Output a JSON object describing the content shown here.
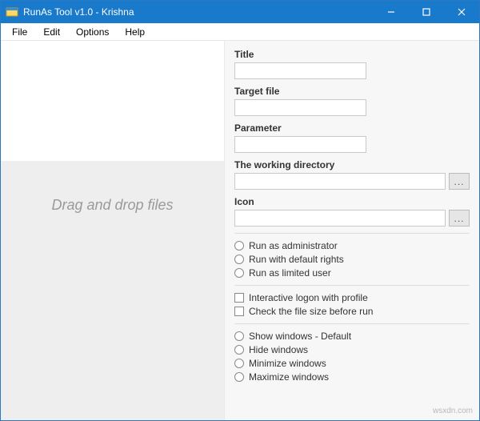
{
  "titlebar": {
    "title": "RunAs Tool v1.0 - Krishna"
  },
  "menu": {
    "file": "File",
    "edit": "Edit",
    "options": "Options",
    "help": "Help"
  },
  "left": {
    "drop_hint": "Drag and drop files"
  },
  "fields": {
    "title": {
      "label": "Title",
      "value": ""
    },
    "target": {
      "label": "Target file",
      "value": ""
    },
    "parameter": {
      "label": "Parameter",
      "value": ""
    },
    "workdir": {
      "label": "The working directory",
      "value": "",
      "browse": "..."
    },
    "icon": {
      "label": "Icon",
      "value": "",
      "browse": "..."
    }
  },
  "run_rights": {
    "admin": "Run as administrator",
    "default": "Run with default rights",
    "limited": "Run as limited user"
  },
  "checks": {
    "interactive": "Interactive logon with profile",
    "filesize": "Check the file size before run"
  },
  "window_opts": {
    "show": "Show windows - Default",
    "hide": "Hide windows",
    "min": "Minimize windows",
    "max": "Maximize windows"
  },
  "watermark": "wsxdn.com"
}
